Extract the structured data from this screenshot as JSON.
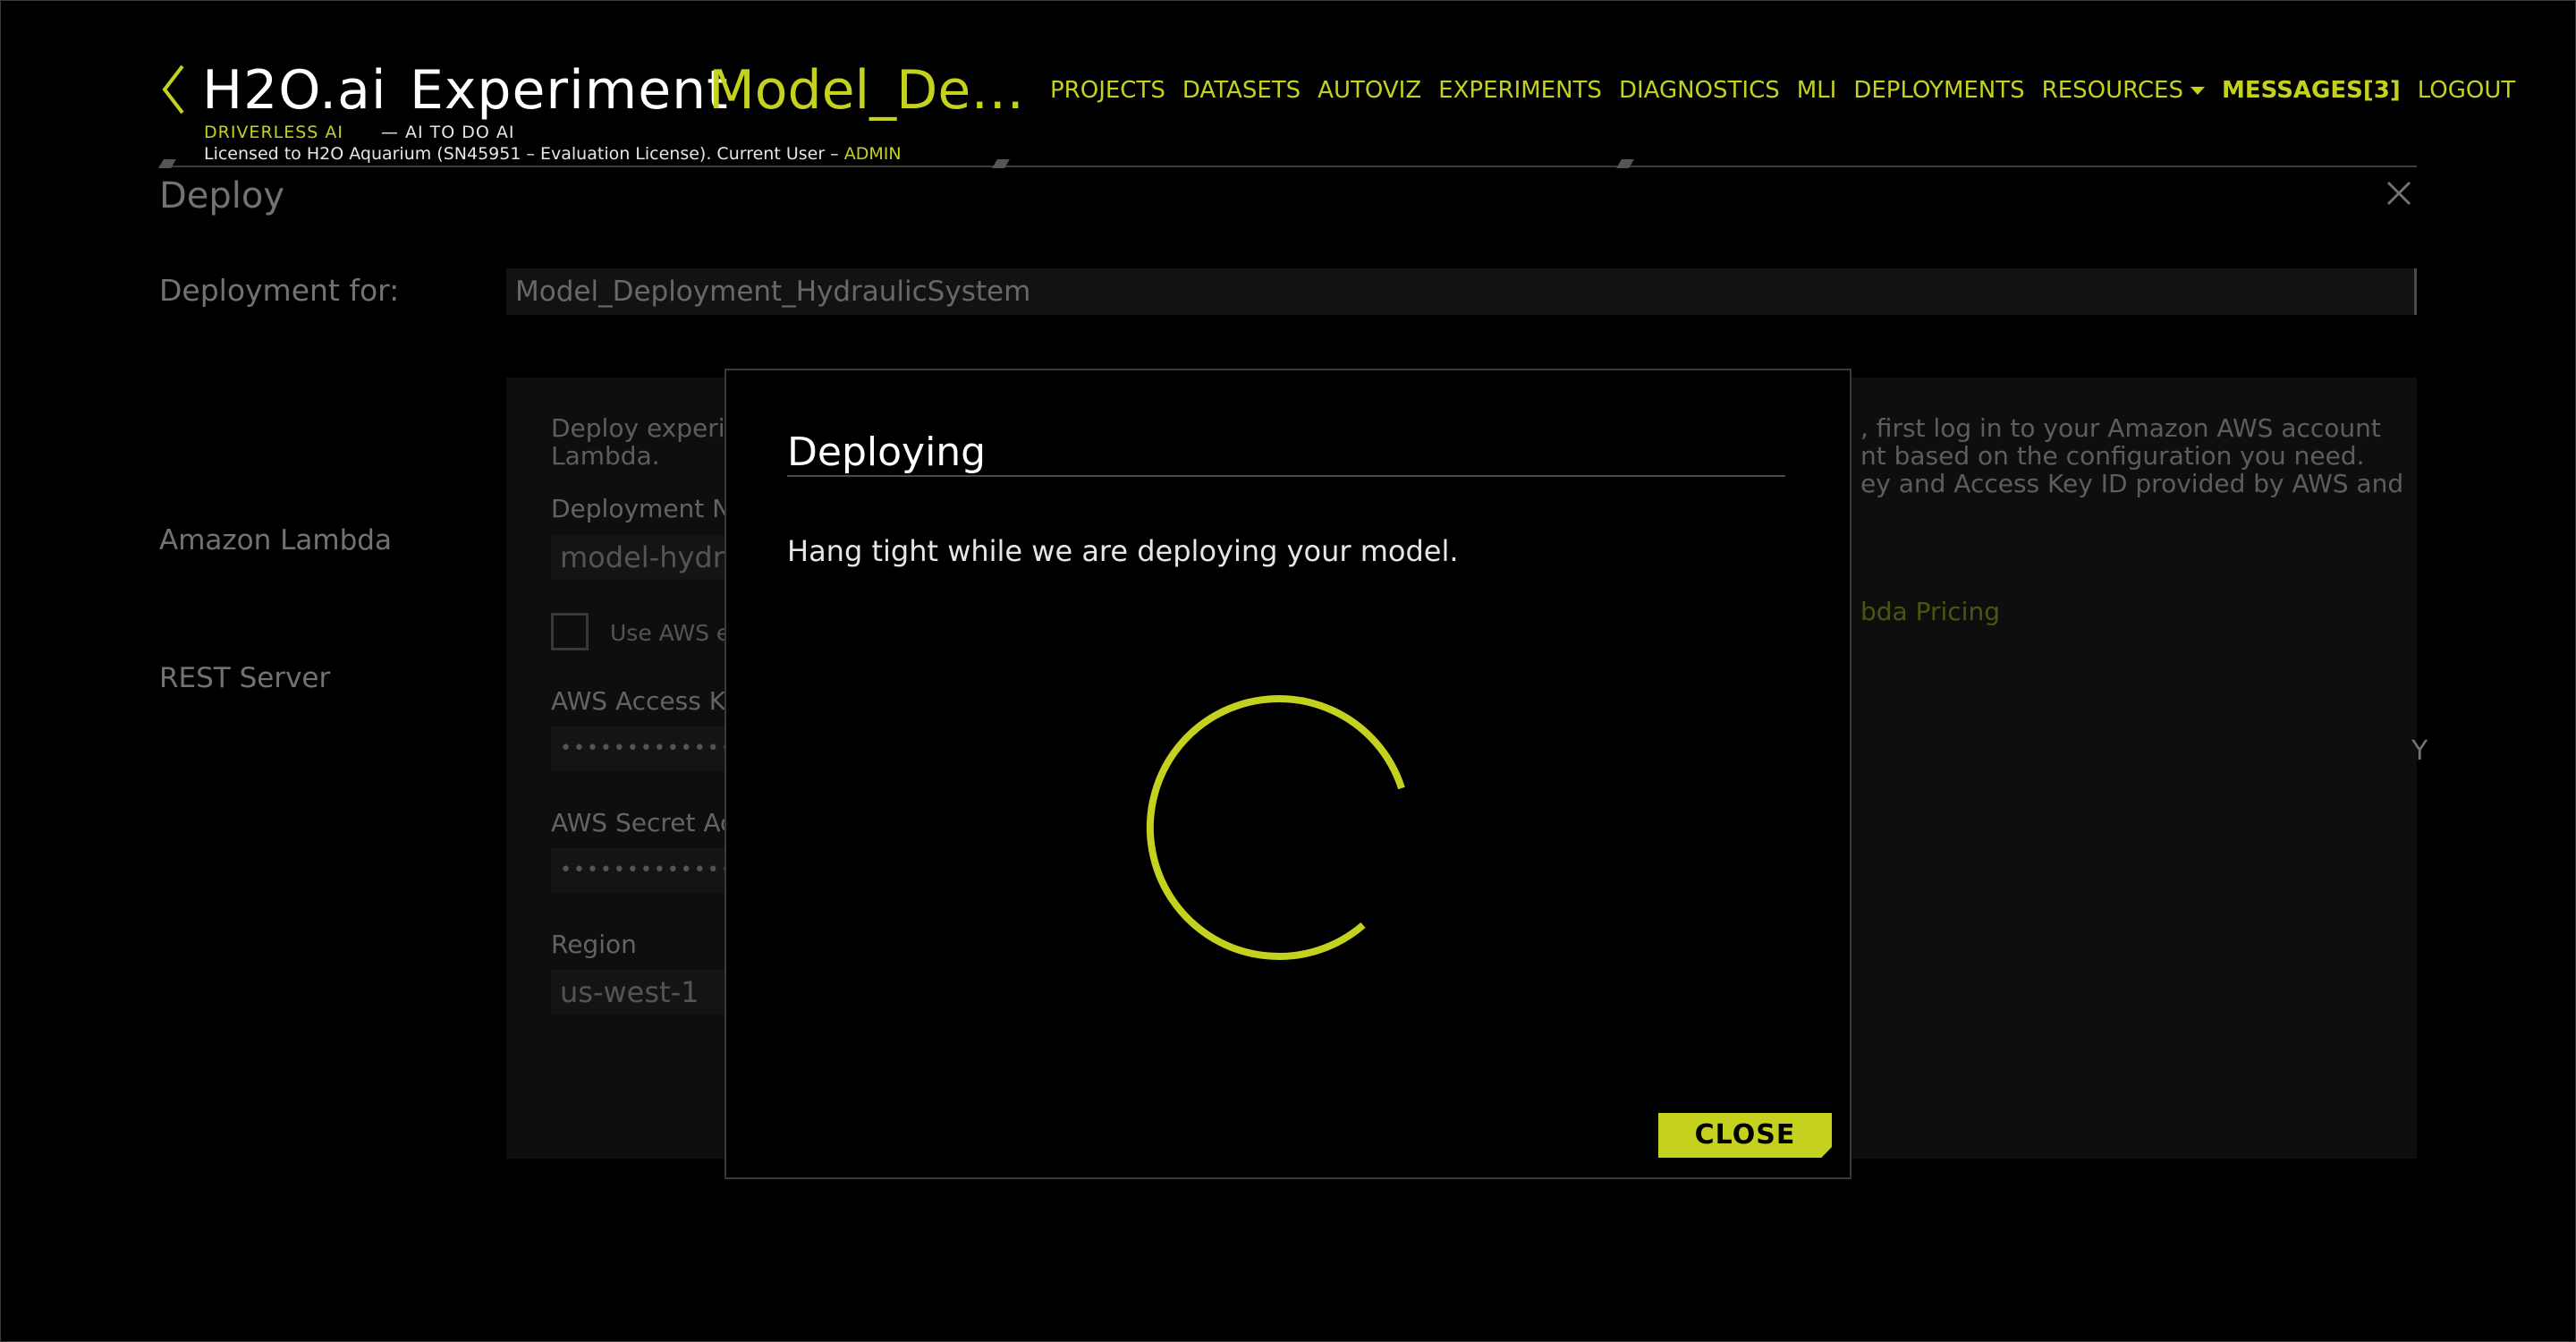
{
  "header": {
    "brand": "H2O.ai",
    "experiment_word": "Experiment",
    "experiment_name": "Model_Deplo...",
    "tagline_product": "DRIVERLESS AI",
    "tagline_slogan": "— AI TO DO AI",
    "license_text": "Licensed to H2O Aquarium (SN45951 – Evaluation License). Current User –",
    "current_user": "ADMIN"
  },
  "nav": {
    "projects": "PROJECTS",
    "datasets": "DATASETS",
    "autoviz": "AUTOVIZ",
    "experiments": "EXPERIMENTS",
    "diagnostics": "DIAGNOSTICS",
    "mli": "MLI",
    "deployments": "DEPLOYMENTS",
    "resources": "RESOURCES",
    "messages": "MESSAGES[3]",
    "logout": "LOGOUT"
  },
  "deploy_panel": {
    "title": "Deploy",
    "deployment_for_label": "Deployment for:",
    "deployment_for_value": "Model_Deployment_HydraulicSystem",
    "options": [
      "Amazon Lambda",
      "REST Server"
    ],
    "description_left_1": "Deploy experim",
    "description_left_2": "Lambda.",
    "description_right_1": ", first log in to your Amazon AWS account",
    "description_right_2": "nt based on the configuration you need.",
    "description_right_3": "ey and Access Key ID provided by AWS and",
    "pricing_link": "bda Pricing",
    "right_edge_text": "Y",
    "deployment_name_label": "Deployment Na",
    "deployment_name_value": "model-hydrau",
    "use_aws_label": "Use AWS er",
    "aws_access_key_label": "AWS Access Key",
    "aws_access_key_value": "••••••••••••••••••",
    "aws_secret_label": "AWS Secret Acc",
    "aws_secret_value": "••••••••••••••••••",
    "region_label": "Region",
    "region_value": "us-west-1"
  },
  "modal": {
    "title": "Deploying",
    "message": "Hang tight while we are deploying your model.",
    "close_label": "CLOSE"
  },
  "colors": {
    "accent": "#c4d21f",
    "background": "#000000"
  },
  "icons": [
    "back-chevron-icon",
    "close-icon",
    "caret-down-icon",
    "loading-spinner-icon"
  ]
}
